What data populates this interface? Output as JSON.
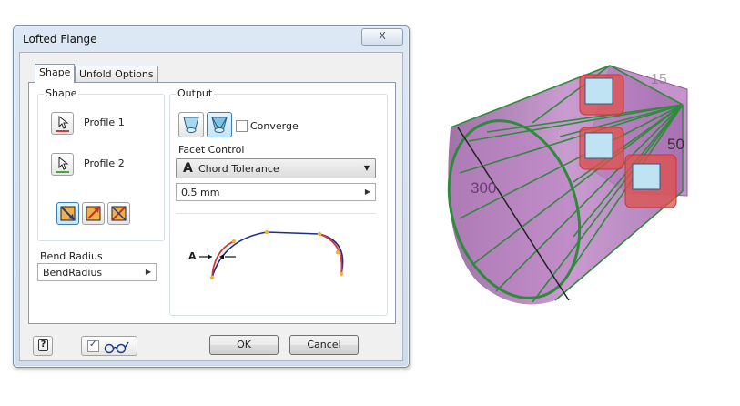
{
  "dialog": {
    "title": "Lofted Flange",
    "close_label": "X",
    "tabs": [
      {
        "label": "Shape",
        "active": true
      },
      {
        "label": "Unfold Options",
        "active": false
      }
    ],
    "shape_group": {
      "label": "Shape",
      "profile1_label": "Profile 1",
      "profile2_label": "Profile 2"
    },
    "bend_radius": {
      "label": "Bend Radius",
      "value": "BendRadius"
    },
    "output_group": {
      "label": "Output",
      "converge_label": "Converge",
      "converge_checked": false,
      "facet_control_label": "Facet Control",
      "facet_control_value": "Chord Tolerance",
      "facet_control_glyph": "A",
      "tolerance_value": "0.5 mm",
      "preview_label": "A"
    },
    "help_glyph": "?",
    "preview_checked": true,
    "ok_label": "OK",
    "cancel_label": "Cancel"
  },
  "viewport": {
    "dimension_large": "300",
    "dimension_small": "50",
    "dimension_partial": "15",
    "colors": {
      "body_fill": "#b07ab8",
      "wire": "#2e8b3c",
      "highlight": "#e0504a"
    }
  }
}
